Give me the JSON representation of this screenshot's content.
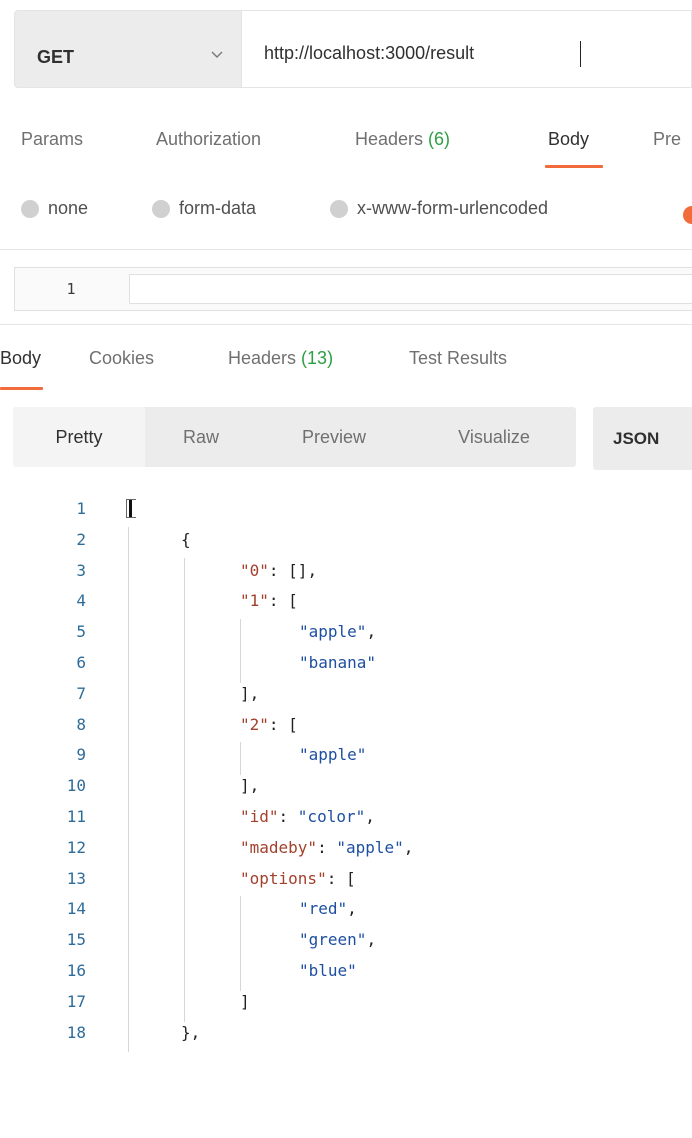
{
  "request": {
    "method": "GET",
    "url": "http://localhost:3000/result"
  },
  "request_tabs": [
    {
      "label": "Params",
      "count": ""
    },
    {
      "label": "Authorization",
      "count": ""
    },
    {
      "label": "Headers ",
      "count": "(6)"
    },
    {
      "label": "Body",
      "count": "",
      "active": true
    },
    {
      "label": "Pre",
      "count": ""
    }
  ],
  "body_types": [
    "none",
    "form-data",
    "x-www-form-urlencoded"
  ],
  "request_editor": {
    "line_number": "1"
  },
  "response_tabs": [
    {
      "label": "Body",
      "count": "",
      "active": true
    },
    {
      "label": "Cookies",
      "count": ""
    },
    {
      "label": "Headers ",
      "count": "(13)"
    },
    {
      "label": "Test Results",
      "count": ""
    }
  ],
  "view_modes": [
    "Pretty",
    "Raw",
    "Preview",
    "Visualize"
  ],
  "active_view": "Pretty",
  "format": "JSON",
  "accent_color": "#f26b3a",
  "count_color": "#2f9e44",
  "response_lines": [
    {
      "n": "1",
      "text": "["
    },
    {
      "n": "2",
      "text": "{"
    },
    {
      "n": "3",
      "key": "\"0\"",
      "rest": ": [],"
    },
    {
      "n": "4",
      "key": "\"1\"",
      "rest": ": ["
    },
    {
      "n": "5",
      "str": "\"apple\"",
      "rest": ","
    },
    {
      "n": "6",
      "str": "\"banana\"",
      "rest": ""
    },
    {
      "n": "7",
      "text": "],"
    },
    {
      "n": "8",
      "key": "\"2\"",
      "rest": ": ["
    },
    {
      "n": "9",
      "str": "\"apple\"",
      "rest": ""
    },
    {
      "n": "10",
      "text": "],"
    },
    {
      "n": "11",
      "key": "\"id\"",
      "rest": ": ",
      "val": "\"color\"",
      "tail": ","
    },
    {
      "n": "12",
      "key": "\"madeby\"",
      "rest": ": ",
      "val": "\"apple\"",
      "tail": ","
    },
    {
      "n": "13",
      "key": "\"options\"",
      "rest": ": ["
    },
    {
      "n": "14",
      "str": "\"red\"",
      "rest": ","
    },
    {
      "n": "15",
      "str": "\"green\"",
      "rest": ","
    },
    {
      "n": "16",
      "str": "\"blue\"",
      "rest": ""
    },
    {
      "n": "17",
      "text": "]"
    },
    {
      "n": "18",
      "text": "},"
    }
  ]
}
